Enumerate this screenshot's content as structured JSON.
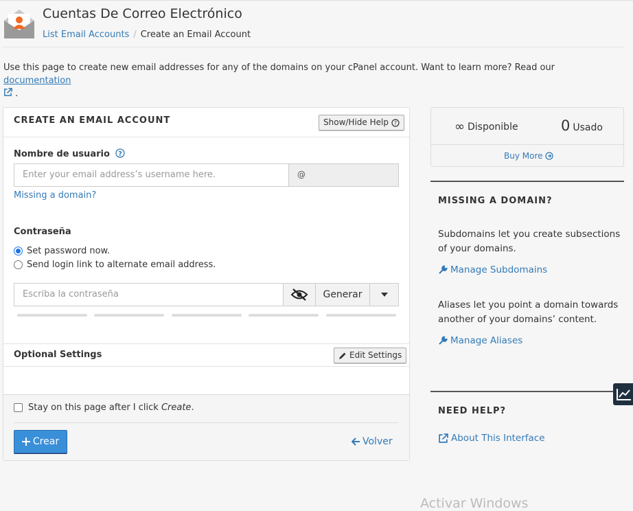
{
  "header": {
    "title": "Cuentas De Correo Electrónico",
    "breadcrumb_link": "List Email Accounts",
    "breadcrumb_separator": "/",
    "breadcrumb_current": "Create an Email Account"
  },
  "intro": {
    "text": "Use this page to create new email addresses for any of the domains on your cPanel account. Want to learn more? Read our ",
    "link_label": "documentation",
    "trailing": "."
  },
  "form": {
    "section_title": "CREATE AN EMAIL ACCOUNT",
    "help_toggle_label": "Show/Hide Help",
    "username_label": "Nombre de usuario",
    "username_placeholder": "Enter your email address’s username here.",
    "username_value": "",
    "domain_prefix": "@",
    "missing_domain_link": "Missing a domain?",
    "password_label": "Contraseña",
    "password_options": [
      {
        "label": "Set password now.",
        "selected": true
      },
      {
        "label": "Send login link to alternate email address.",
        "selected": false
      }
    ],
    "password_placeholder": "Escriba la contraseña",
    "password_value": "",
    "generate_label": "Generar",
    "strength_segments": 5,
    "optional_settings_label": "Optional Settings",
    "edit_settings_label": "Edit Settings",
    "stay_on_page_prefix": "Stay on this page after I click ",
    "stay_on_page_em": "Create",
    "stay_on_page_suffix": ".",
    "stay_on_page_checked": false,
    "create_label": "Crear",
    "back_label": "Volver"
  },
  "stats": {
    "available_symbol": "∞",
    "available_label": "Disponible",
    "used_value": "0",
    "used_label": "Usado",
    "buy_more_label": "Buy More"
  },
  "sidebar": {
    "missing_domain_heading": "MISSING A DOMAIN?",
    "subdomains_text": "Subdomains let you create subsections of your domains.",
    "manage_subdomains_label": "Manage Subdomains",
    "aliases_text": "Aliases let you point a domain towards another of your domains’ content.",
    "manage_aliases_label": "Manage Aliases",
    "need_help_heading": "NEED HELP?",
    "about_interface_label": "About This Interface"
  },
  "overlay": {
    "watermark": "Activar Windows"
  },
  "colors": {
    "accent": "#337ab7",
    "primary_button": "#3a8fd9",
    "icon_orange": "#f26a21"
  }
}
